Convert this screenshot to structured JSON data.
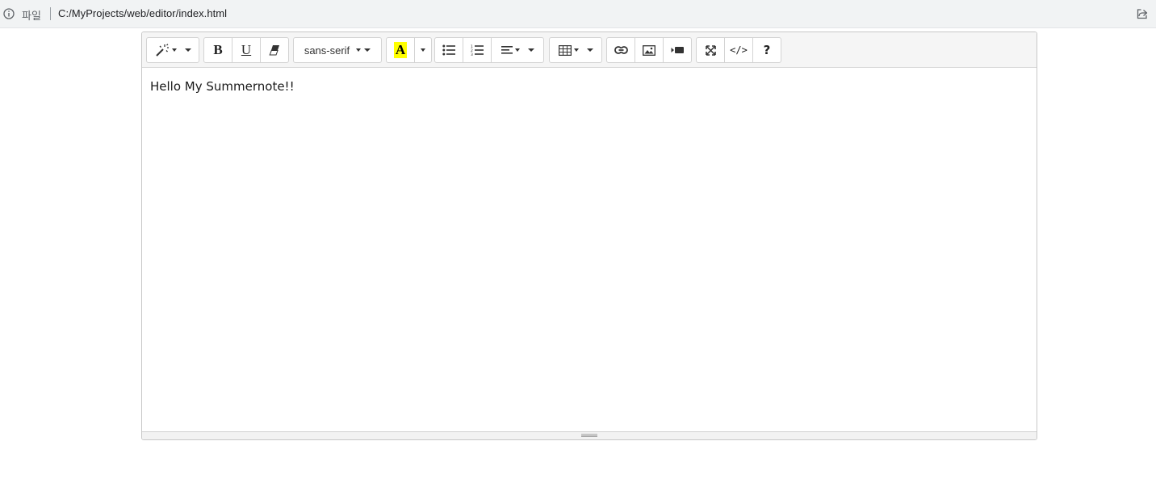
{
  "browser": {
    "scheme_label": "파일",
    "url": "C:/MyProjects/web/editor/index.html",
    "icons": {
      "info": "info-icon",
      "share": "share-icon"
    }
  },
  "toolbar": {
    "style_icon": "magic-wand-icon",
    "bold_label": "B",
    "underline_label": "U",
    "clear_icon": "eraser-icon",
    "font_family": "sans-serif",
    "color_label": "A",
    "color_highlight": "#ffff00",
    "unordered_list_icon": "unordered-list-icon",
    "ordered_list_icon": "ordered-list-icon",
    "paragraph_icon": "align-left-icon",
    "table_icon": "table-icon",
    "link_icon": "link-icon",
    "picture_icon": "picture-icon",
    "video_icon": "video-icon",
    "fullscreen_icon": "fullscreen-icon",
    "codeview_label": "</>",
    "help_label": "?"
  },
  "editor": {
    "content": "Hello My Summernote!!"
  }
}
